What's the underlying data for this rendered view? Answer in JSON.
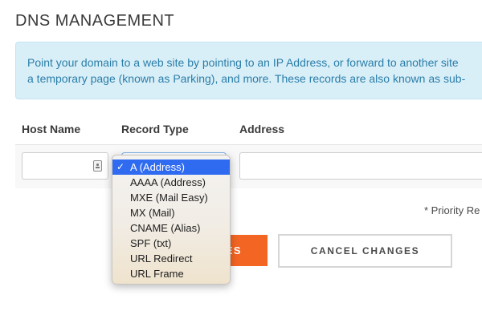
{
  "page": {
    "title": "DNS MANAGEMENT",
    "info": {
      "line1": "Point your domain to a web site by pointing to an IP Address, or forward to another site",
      "line2": "a temporary page (known as Parking), and more. These records are also known as sub-"
    }
  },
  "table": {
    "headers": {
      "host_name": "Host Name",
      "record_type": "Record Type",
      "address": "Address"
    }
  },
  "record_type_dropdown": {
    "selected": "A (Address)",
    "options": [
      "A (Address)",
      "AAAA (Address)",
      "MXE (Mail Easy)",
      "MX (Mail)",
      "CNAME (Alias)",
      "SPF (txt)",
      "URL Redirect",
      "URL Frame"
    ],
    "check_mark": "✓"
  },
  "notes": {
    "priority": "* Priority Re"
  },
  "buttons": {
    "save_label": "ES",
    "cancel_label": "CANCEL CHANGES"
  },
  "colors": {
    "info_bg": "#d9eff8",
    "info_text": "#2a7da8",
    "save_bg": "#f26522",
    "dropdown_highlight": "#2f6bf0"
  }
}
